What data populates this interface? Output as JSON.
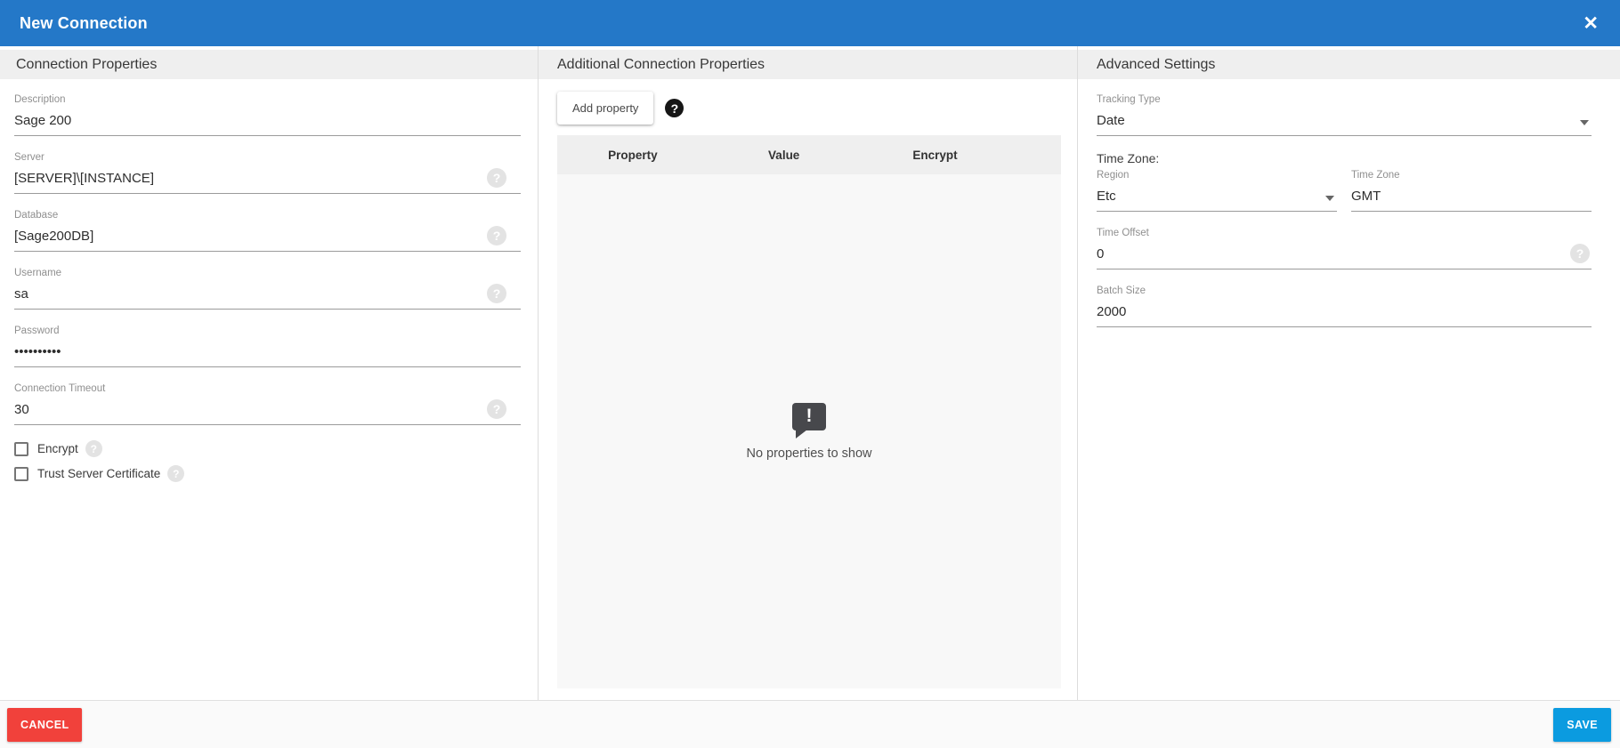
{
  "titlebar": {
    "title": "New Connection"
  },
  "icons": {
    "close": "✕",
    "help": "?",
    "exclamation": "!"
  },
  "colors": {
    "titlebar_bg": "#2478c8",
    "section_band_bg": "#efefef",
    "cancel_bg": "#f1413b",
    "save_bg": "#0b9be0",
    "field_underline": "#9b9b9b",
    "empty_icon_bg": "#47484c"
  },
  "connection": {
    "section_title": "Connection Properties",
    "description": {
      "label": "Description",
      "value": "Sage 200"
    },
    "server": {
      "label": "Server",
      "value": "[SERVER]\\[INSTANCE]"
    },
    "database": {
      "label": "Database",
      "value": "[Sage200DB]"
    },
    "username": {
      "label": "Username",
      "value": "sa"
    },
    "password": {
      "label": "Password",
      "value": "••••••••••"
    },
    "timeout": {
      "label": "Connection Timeout",
      "value": "30"
    },
    "checkboxes": {
      "encrypt": "Encrypt",
      "trust": "Trust Server Certificate"
    }
  },
  "additional": {
    "section_title": "Additional Connection Properties",
    "add_button": "Add property",
    "columns": {
      "property": "Property",
      "value": "Value",
      "encrypt": "Encrypt"
    },
    "empty_message": "No properties to show"
  },
  "advanced": {
    "section_title": "Advanced Settings",
    "tracking_type": {
      "label": "Tracking Type",
      "value": "Date"
    },
    "time_zone_heading": "Time Zone:",
    "region": {
      "label": "Region",
      "value": "Etc"
    },
    "time_zone": {
      "label": "Time Zone",
      "value": "GMT"
    },
    "time_offset": {
      "label": "Time Offset",
      "value": "0"
    },
    "batch_size": {
      "label": "Batch Size",
      "value": "2000"
    }
  },
  "footer": {
    "cancel": "CANCEL",
    "save": "SAVE"
  }
}
